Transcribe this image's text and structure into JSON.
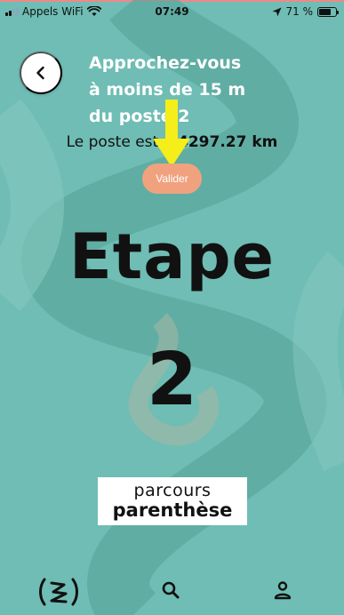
{
  "status_bar": {
    "carrier": "Appels WiFi",
    "time": "07:49",
    "battery": "71 %",
    "battery_level": 0.71
  },
  "header": {
    "title_lines": [
      "Approchez-vous",
      "à moins de 15 m",
      "du poste 2"
    ]
  },
  "distance": {
    "label": "Le poste est à",
    "value": "4297.27 km"
  },
  "validate_button": {
    "label": "Valider"
  },
  "step": {
    "label": "Etape",
    "number": "2"
  },
  "logo": {
    "line1": "parcours",
    "line2": "parenthèse"
  },
  "bottom_nav": {
    "items": [
      "home-logo-icon",
      "search-icon",
      "profile-icon"
    ]
  },
  "colors": {
    "background": "#6fbdb4",
    "accent_button": "#f0a27f",
    "arrow": "#f5ee1a"
  }
}
